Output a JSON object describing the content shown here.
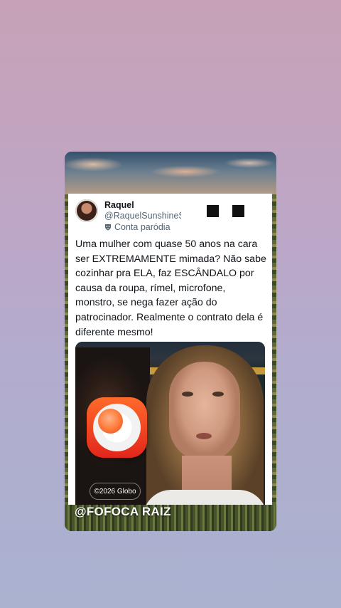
{
  "tweet": {
    "author_name": "Raquel",
    "author_handle": "@RaquelSunshineS",
    "parody_label": "Conta paródia",
    "parody_icon": "mask-icon",
    "text": "Uma mulher com quase 50 anos na cara ser EXTREMAMENTE mimada? Não sabe cozinhar pra ELA, faz ESCÂNDALO por causa da roupa, rímel, microfone, monstro, se nega fazer ação do patrocinador. Realmente o contrato dela é diferente mesmo!"
  },
  "media": {
    "logo_icon": "globo-logo-icon",
    "copyright_tag": "©2026 Globo"
  },
  "watermark": {
    "text": "@FOFOCA RAIZ"
  },
  "colors": {
    "background_top": "#c7a2b6",
    "background_bottom": "#aab2d0",
    "globo_orange": "#ff6a2a",
    "globo_red": "#e2261b",
    "text_primary": "#0f1419",
    "text_secondary": "#536471"
  }
}
